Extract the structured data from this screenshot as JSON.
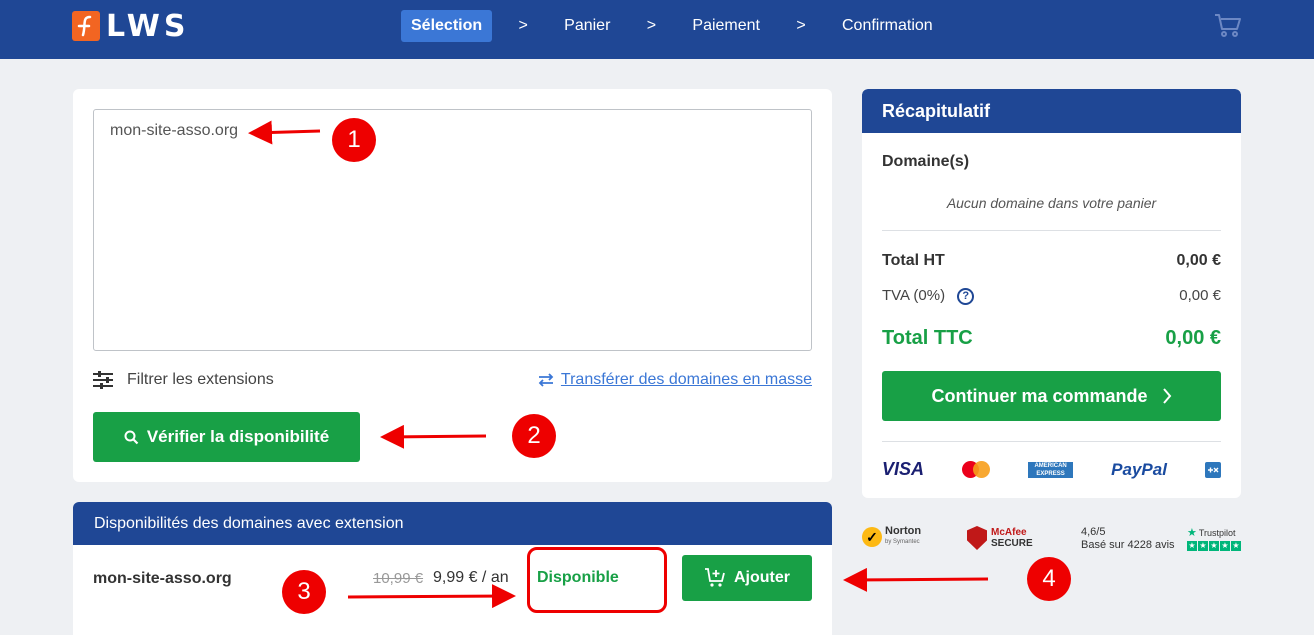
{
  "header": {
    "logo_text": "LWS",
    "steps": [
      "Sélection",
      "Panier",
      "Paiement",
      "Confirmation"
    ],
    "chevron": ">"
  },
  "search": {
    "textarea_value": "mon-site-asso.org",
    "filter_label": "Filtrer les extensions",
    "transfer_label": "Transférer des domaines en masse",
    "verify_label": "Vérifier la disponibilité"
  },
  "results": {
    "header": "Disponibilités des domaines avec extension",
    "rows": [
      {
        "domain": "mon-site-asso.org",
        "old_price": "10,99 €",
        "price": "9,99 € / an",
        "status": "Disponible",
        "add_label": "Ajouter"
      }
    ]
  },
  "summary": {
    "title": "Récapitulatif",
    "domains_title": "Domaine(s)",
    "empty_message": "Aucun domaine dans votre panier",
    "total_ht_label": "Total HT",
    "total_ht_value": "0,00 €",
    "tva_label": "TVA (0%)",
    "tva_value": "0,00 €",
    "total_ttc_label": "Total TTC",
    "total_ttc_value": "0,00 €",
    "continue_label": "Continuer ma commande",
    "payments": {
      "visa": "VISA",
      "amex": "AMERICAN EXPRESS",
      "paypal": "PayPal"
    }
  },
  "trust": {
    "norton": "Norton",
    "norton_sub": "by Symantec",
    "mcafee": "McAfee",
    "mcafee_sub": "SECURE",
    "rating_score": "4,6/5",
    "rating_count": "Basé sur 4228 avis",
    "trustpilot": "Trustpilot"
  },
  "annotations": [
    "1",
    "2",
    "3",
    "4"
  ],
  "colors": {
    "brand_blue": "#1f4795",
    "active_step": "#3b77d6",
    "green": "#18a046",
    "logo_orange": "#f26522",
    "annotation_red": "#e00000"
  }
}
